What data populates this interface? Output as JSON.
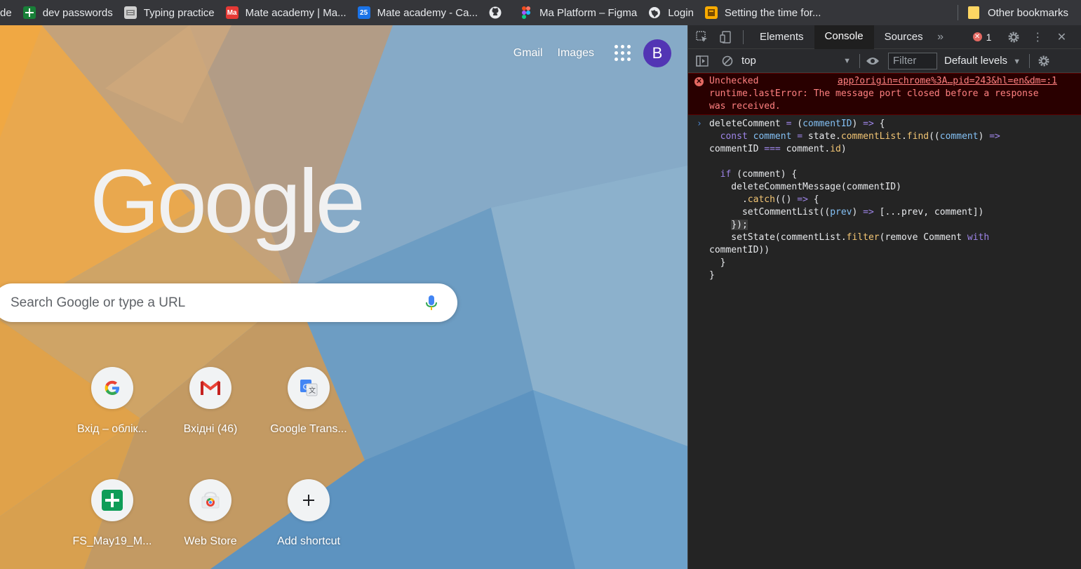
{
  "bookmarks": {
    "items": [
      {
        "label": "de",
        "icon": "bookmark-icon",
        "color": ""
      },
      {
        "label": "dev passwords",
        "icon": "sheets-icon",
        "color": "#188038"
      },
      {
        "label": "Typing practice",
        "icon": "typing-icon",
        "color": "#cfcfcf"
      },
      {
        "label": "Mate academy | Ma...",
        "icon": "mate-icon",
        "color": "#e53935"
      },
      {
        "label": "Mate academy - Ca...",
        "icon": "calendar-icon",
        "color": "#1a73e8",
        "badge": "25"
      },
      {
        "label": "",
        "icon": "github-icon",
        "color": "#e8eaed"
      },
      {
        "label": "Ma Platform – Figma",
        "icon": "figma-icon",
        "color": "#f24e1e"
      },
      {
        "label": "Login",
        "icon": "globe-icon",
        "color": "#e8eaed"
      },
      {
        "label": "Setting the time for...",
        "icon": "box-icon",
        "color": "#f9ab00"
      }
    ],
    "other": "Other bookmarks"
  },
  "ntp": {
    "gmail": "Gmail",
    "images": "Images",
    "avatar_letter": "B",
    "logo": "Google",
    "search_placeholder": "Search Google or type a URL",
    "tiles": [
      {
        "label": "Вхід – облік...",
        "icon": "google-g-icon"
      },
      {
        "label": "Вхідні (46)",
        "icon": "gmail-icon"
      },
      {
        "label": "Google Trans...",
        "icon": "translate-icon"
      },
      {
        "label": "FS_May19_M...",
        "icon": "sheets-icon"
      },
      {
        "label": "Web Store",
        "icon": "webstore-icon"
      },
      {
        "label": "Add shortcut",
        "icon": "plus-icon"
      }
    ]
  },
  "devtools": {
    "tabs": [
      "Elements",
      "Console",
      "Sources"
    ],
    "active_tab": "Console",
    "error_count": "1",
    "context": "top",
    "filter_placeholder": "Filter",
    "levels": "Default levels",
    "error": {
      "text_line1": "Unchecked",
      "link": "app?origin=chrome%3A…pid=243&hl=en&dm=:1",
      "text_rest": "runtime.lastError: The message port closed before a response\nwas received."
    }
  }
}
